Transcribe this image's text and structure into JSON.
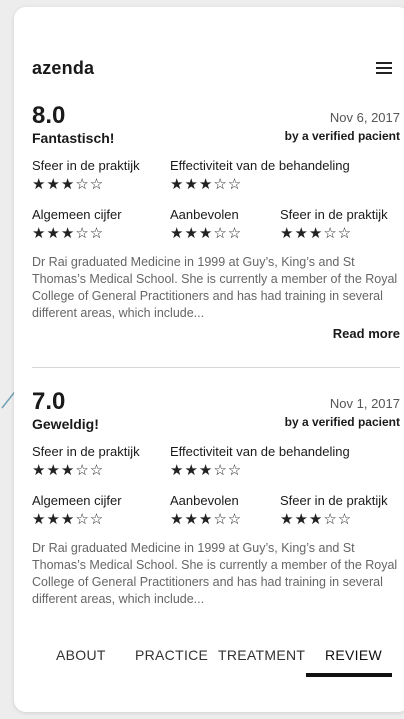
{
  "app": {
    "logo": "azenda"
  },
  "reviews": [
    {
      "score": "8.0",
      "headline": "Fantastisch!",
      "date": "Nov 6, 2017",
      "author": "by a verified pacient",
      "ratings_top": [
        {
          "label": "Sfeer in de praktijk",
          "stars": 3
        },
        {
          "label": "Effectiviteit van de behandeling",
          "stars": 3
        }
      ],
      "ratings_bottom": [
        {
          "label": "Algemeen cijfer",
          "stars": 3
        },
        {
          "label": "Aanbevolen",
          "stars": 3
        },
        {
          "label": "Sfeer in de praktijk",
          "stars": 3
        }
      ],
      "description": "Dr Rai graduated Medicine in 1999 at Guy’s, King’s and St Thomas’s Medical School. She is currently a member of the Royal College of General Practitioners and has had training in several different areas, which include...",
      "read_more": "Read more"
    },
    {
      "score": "7.0",
      "headline": "Geweldig!",
      "date": "Nov 1, 2017",
      "author": "by a verified pacient",
      "ratings_top": [
        {
          "label": "Sfeer in de praktijk",
          "stars": 3
        },
        {
          "label": "Effectiviteit van de behandeling",
          "stars": 3
        }
      ],
      "ratings_bottom": [
        {
          "label": "Algemeen cijfer",
          "stars": 3
        },
        {
          "label": "Aanbevolen",
          "stars": 3
        },
        {
          "label": "Sfeer in de praktijk",
          "stars": 3
        }
      ],
      "description": "Dr Rai graduated Medicine in 1999 at Guy’s, King’s and St Thomas’s Medical School. She is currently a member of the Royal College of General Practitioners and has had training in several different areas, which include..."
    }
  ],
  "tabs": [
    {
      "label": "ABOUT",
      "active": false
    },
    {
      "label": "PRACTICE",
      "active": false
    },
    {
      "label": "TREATMENT",
      "active": false
    },
    {
      "label": "REVIEW",
      "active": true
    }
  ],
  "stars_max": 5,
  "colors": {
    "arrow": "#6f9fb5",
    "accent": "#111111"
  },
  "icons": {
    "menu": "hamburger-menu-icon",
    "arrow": "annotation-arrow-icon"
  }
}
